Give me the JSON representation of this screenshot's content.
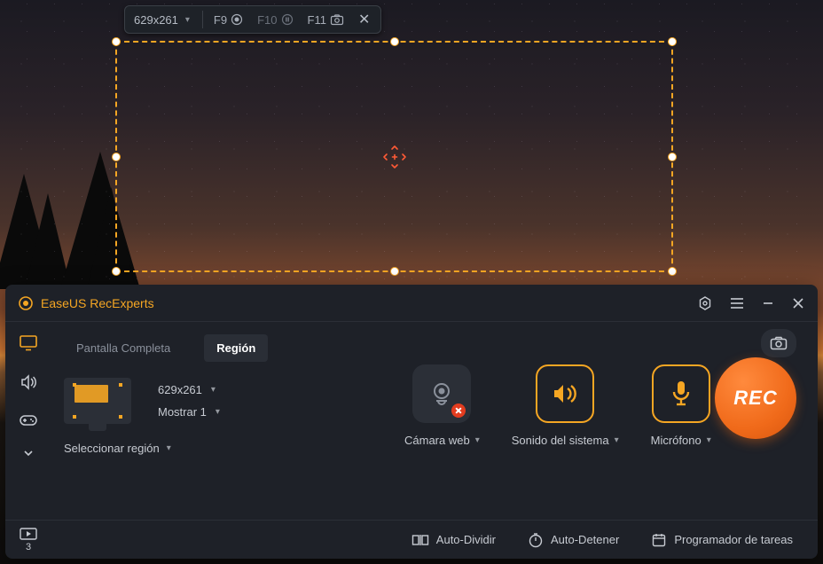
{
  "colors": {
    "accent": "#f5a623",
    "rec": "#f06a1a"
  },
  "selection": {
    "dimensions": "629x261"
  },
  "top_toolbar": {
    "dimensions_label": "629x261",
    "hotkeys": {
      "record": "F9",
      "pause": "F10",
      "screenshot": "F11"
    }
  },
  "app": {
    "title": "EaseUS RecExperts",
    "tabs": {
      "fullscreen": "Pantalla Completa",
      "region": "Región",
      "active": "region"
    },
    "region": {
      "resolution": "629x261",
      "display_label": "Mostrar 1",
      "select_label": "Seleccionar región"
    },
    "tiles": {
      "webcam": {
        "label": "Cámara web",
        "active": false
      },
      "system": {
        "label": "Sonido del sistema",
        "active": true
      },
      "mic": {
        "label": "Micrófono",
        "active": true
      }
    },
    "rec_button": "REC",
    "footer": {
      "recordings_count": "3",
      "auto_split": "Auto-Dividir",
      "auto_stop": "Auto-Detener",
      "scheduler": "Programador de tareas"
    }
  }
}
